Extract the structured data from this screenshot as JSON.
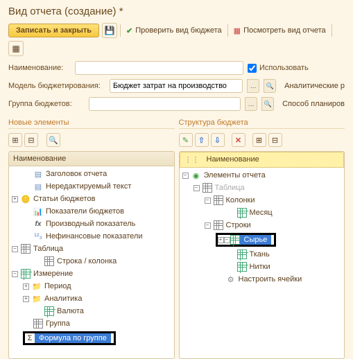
{
  "window_title": "Вид отчета (создание) *",
  "toolbar": {
    "save_close": "Записать и закрыть",
    "check_budget": "Проверить вид бюджета",
    "view_report": "Посмотреть вид отчета"
  },
  "form": {
    "name_label": "Наименование:",
    "name_value": "",
    "use_label": "Использовать",
    "model_label": "Модель бюджетирования:",
    "model_value": "Бюджет затрат на производство",
    "analytic_label": "Аналитические р",
    "group_label": "Группа бюджетов:",
    "group_value": "",
    "plan_label": "Способ планиров"
  },
  "left": {
    "section": "Новые элементы",
    "header": "Наименование",
    "items": [
      "Заголовок отчета",
      "Нередактируемый текст",
      "Статьи бюджетов",
      "Показатели бюджетов",
      "Производный показатель",
      "Нефинансовые показатели",
      "Таблица",
      "Строка / колонка",
      "Измерение",
      "Период",
      "Аналитика",
      "Валюта",
      "Группа",
      "Формула по группе"
    ]
  },
  "right": {
    "section": "Структура бюджета",
    "header": "Наименование",
    "items": [
      "Элементы отчета",
      "Таблица",
      "Колонки",
      "Месяц",
      "Строки",
      "Сырье",
      "Ткань",
      "Нитки",
      "Настроить ячейки"
    ]
  }
}
